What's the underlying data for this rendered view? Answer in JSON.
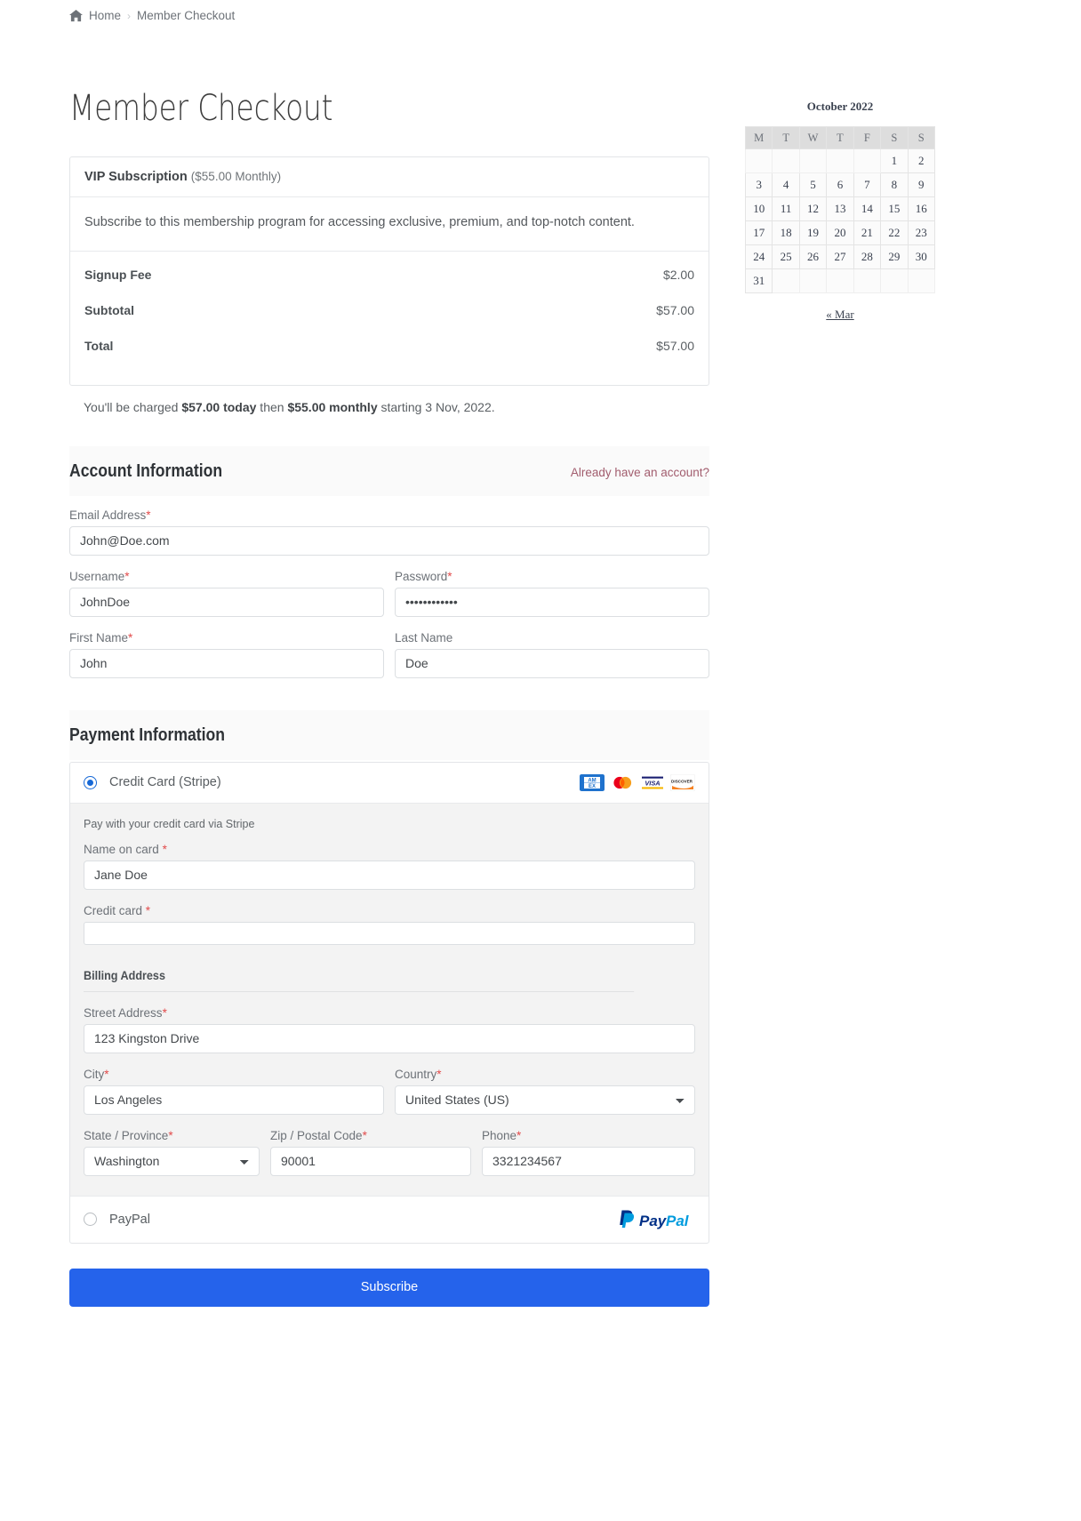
{
  "breadcrumb": {
    "home_icon": "home-icon",
    "home_label": "Home",
    "separator": "›",
    "current": "Member Checkout"
  },
  "page_title": "Member Checkout",
  "level": {
    "name": "VIP Subscription",
    "price_note": "($55.00 Monthly)",
    "description": "Subscribe to this membership program for accessing exclusive, premium, and top-notch content.",
    "totals": [
      {
        "label": "Signup Fee",
        "value": "$2.00"
      },
      {
        "label": "Subtotal",
        "value": "$57.00"
      },
      {
        "label": "Total",
        "value": "$57.00"
      }
    ],
    "charge_note": {
      "prefix": "You'll be charged ",
      "today_amount": "$57.00 today",
      "middle": " then ",
      "recurring_amount": "$55.00 monthly",
      "suffix": " starting 3 Nov, 2022."
    }
  },
  "account": {
    "heading": "Account Information",
    "login_link": "Already have an account?",
    "email": {
      "label": "Email Address",
      "required": "*",
      "value": "John@Doe.com"
    },
    "username": {
      "label": "Username",
      "required": "*",
      "value": "JohnDoe"
    },
    "password": {
      "label": "Password",
      "required": "*",
      "value": "••••••••••••"
    },
    "first_name": {
      "label": "First Name",
      "required": "*",
      "value": "John"
    },
    "last_name": {
      "label": "Last Name",
      "required": "",
      "value": "Doe"
    }
  },
  "payment": {
    "heading": "Payment Information",
    "stripe": {
      "label": "Credit Card (Stripe)",
      "selected": true,
      "note": "Pay with your credit card via Stripe",
      "card_icons": [
        "amex-icon",
        "mastercard-icon",
        "visa-icon",
        "discover-icon"
      ],
      "name_on_card": {
        "label": "Name on card",
        "required": "*",
        "value": "Jane Doe"
      },
      "credit_card": {
        "label": "Credit card",
        "required": "*",
        "value": ""
      }
    },
    "billing": {
      "heading": "Billing Address",
      "street": {
        "label": "Street Address",
        "required": "*",
        "value": "123 Kingston Drive"
      },
      "city": {
        "label": "City",
        "required": "*",
        "value": "Los Angeles"
      },
      "country": {
        "label": "Country",
        "required": "*",
        "value": "United States (US)"
      },
      "state": {
        "label": "State / Province",
        "required": "*",
        "value": "Washington"
      },
      "zip": {
        "label": "Zip / Postal Code",
        "required": "*",
        "value": "90001"
      },
      "phone": {
        "label": "Phone",
        "required": "*",
        "value": "3321234567"
      }
    },
    "paypal": {
      "label": "PayPal",
      "selected": false,
      "logo_text_1": "Pay",
      "logo_text_2": "Pal"
    }
  },
  "submit_label": "Subscribe",
  "calendar": {
    "caption": "October 2022",
    "weekdays": [
      "M",
      "T",
      "W",
      "T",
      "F",
      "S",
      "S"
    ],
    "weeks": [
      [
        "",
        "",
        "",
        "",
        "",
        "1",
        "2"
      ],
      [
        "3",
        "4",
        "5",
        "6",
        "7",
        "8",
        "9"
      ],
      [
        "10",
        "11",
        "12",
        "13",
        "14",
        "15",
        "16"
      ],
      [
        "17",
        "18",
        "19",
        "20",
        "21",
        "22",
        "23"
      ],
      [
        "24",
        "25",
        "26",
        "27",
        "28",
        "29",
        "30"
      ],
      [
        "31",
        "",
        "",
        "",
        "",
        "",
        ""
      ]
    ],
    "prev_link": "« Mar"
  },
  "colors": {
    "accent_blue": "#2563eb",
    "radio_blue": "#1668d6",
    "required_red": "#e24b4b",
    "link_mauve": "#a25d6e"
  }
}
